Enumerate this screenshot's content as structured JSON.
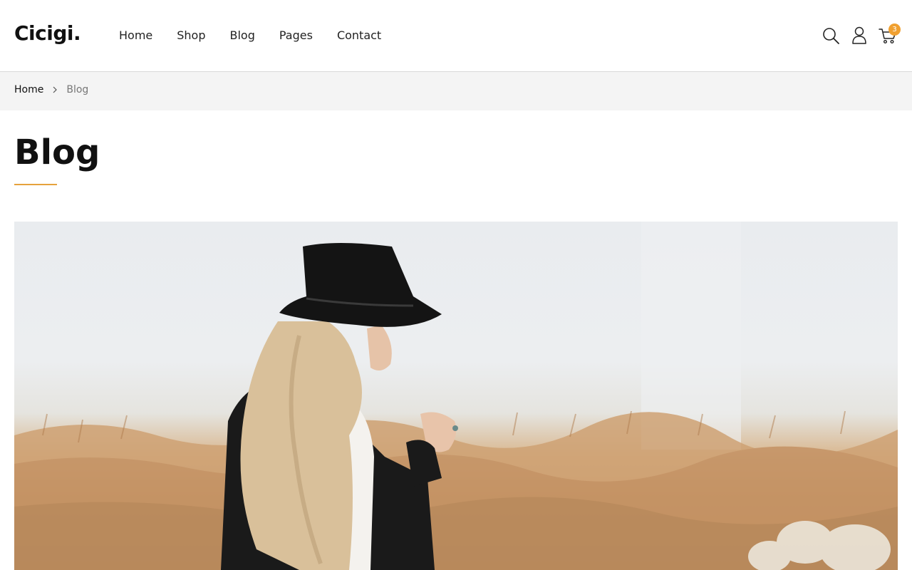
{
  "brand": {
    "logo_text": "Cicigi."
  },
  "nav": {
    "items": [
      {
        "label": "Home"
      },
      {
        "label": "Shop"
      },
      {
        "label": "Blog"
      },
      {
        "label": "Pages"
      },
      {
        "label": "Contact"
      }
    ]
  },
  "tools": {
    "search_icon": "search-icon",
    "account_icon": "user-icon",
    "cart_icon": "cart-icon",
    "cart_count": "3"
  },
  "breadcrumb": {
    "home": "Home",
    "separator_icon": "chevron-right-icon",
    "current": "Blog"
  },
  "page": {
    "title": "Blog"
  },
  "colors": {
    "accent": "#e6a23c",
    "badge": "#f0a030",
    "breadcrumb_bg": "#f4f4f4"
  }
}
